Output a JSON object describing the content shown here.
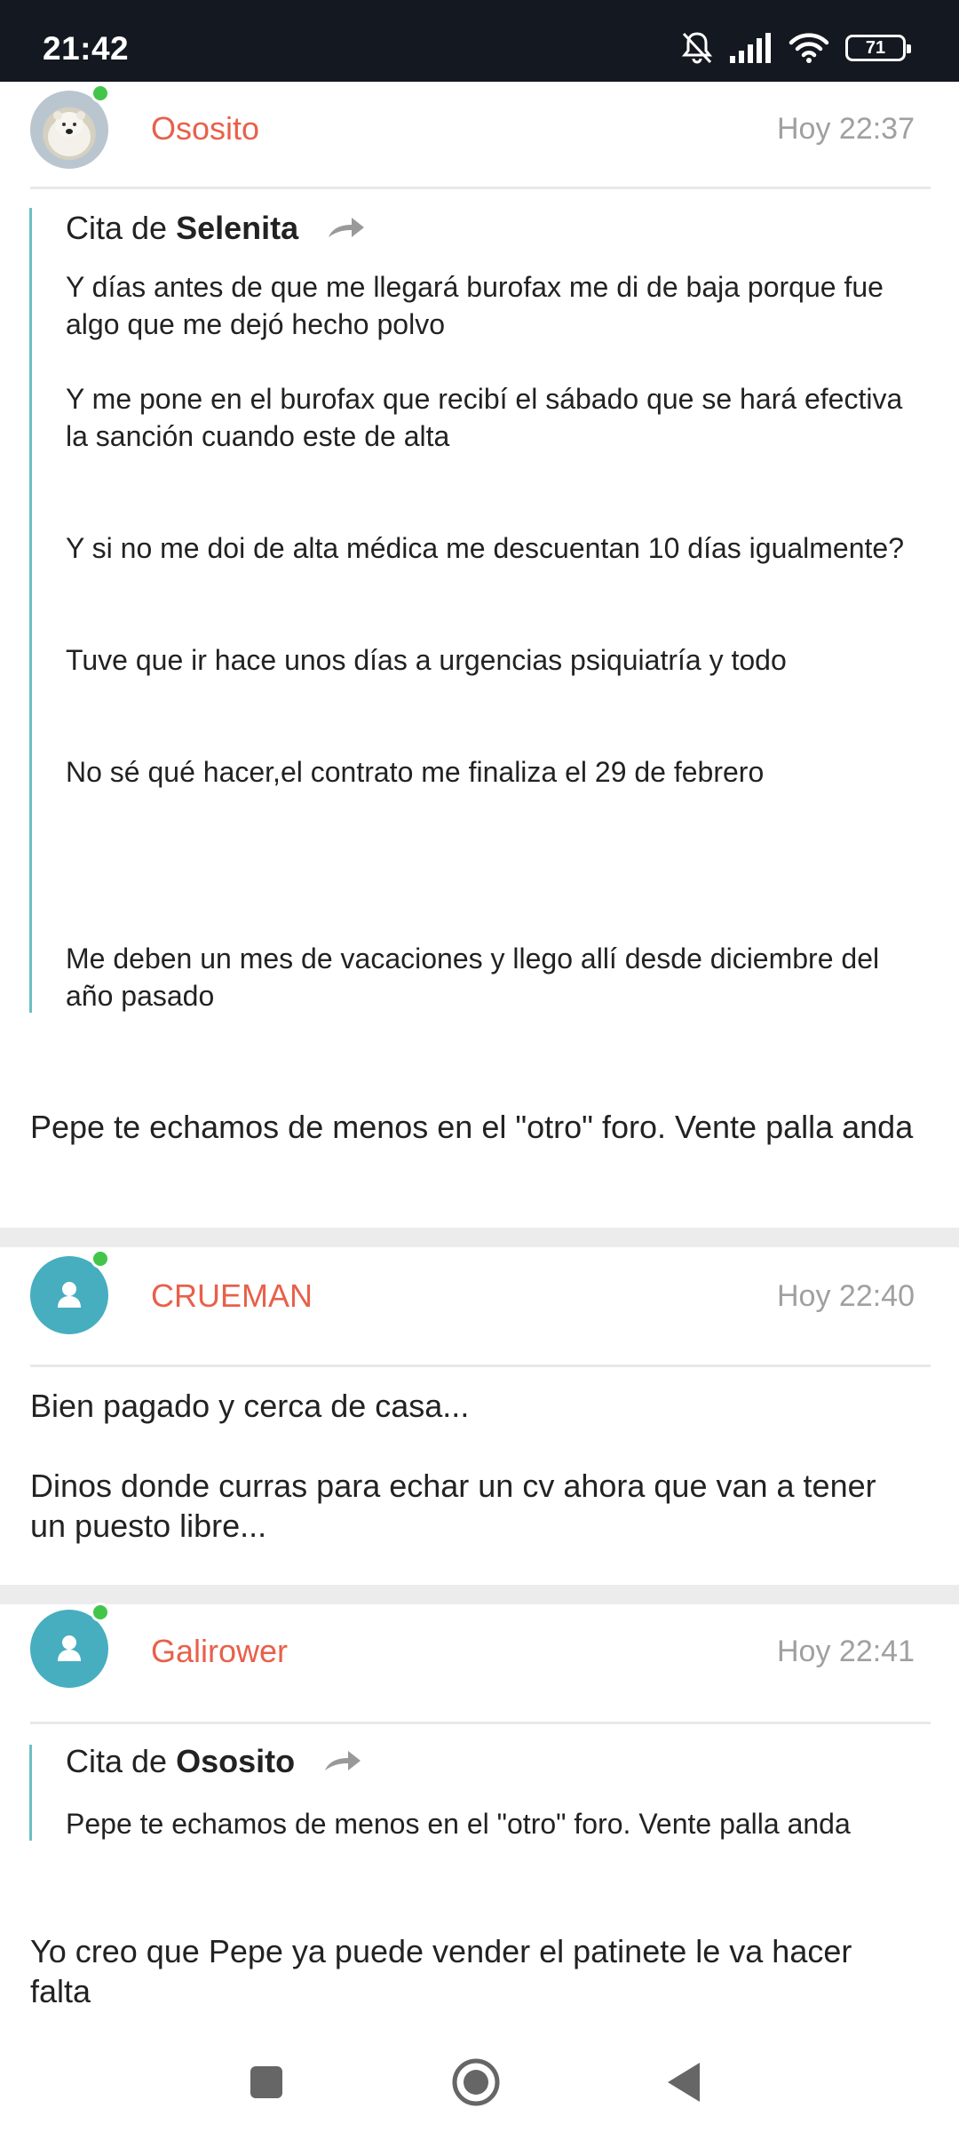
{
  "status_bar": {
    "time": "21:42",
    "battery": "71"
  },
  "posts": [
    {
      "username": "Ososito",
      "time": "Hoy 22:37",
      "quote": {
        "prefix": "Cita de",
        "author": "Selenita",
        "paragraphs": [
          "Y días antes de que me llegará burofax me di de baja porque fue algo que me dejó hecho polvo",
          "Y me pone en el burofax que recibí el sábado que se hará efectiva la sanción cuando este de alta",
          "Y si no me doi de alta médica me descuentan 10 días igualmente?",
          "Tuve que ir hace unos días a urgencias psiquiatría y todo",
          "No sé qué hacer,el contrato me finaliza el 29 de febrero",
          "Me deben un mes de vacaciones y llego allí desde diciembre del año pasado"
        ]
      },
      "body": [
        "Pepe te echamos de menos en el \"otro\" foro. Vente palla anda"
      ]
    },
    {
      "username": "CRUEMAN",
      "time": "Hoy 22:40",
      "body": [
        "Bien pagado y cerca de casa...",
        "Dinos donde curras para echar un cv ahora que van a tener un puesto libre..."
      ]
    },
    {
      "username": "Galirower",
      "time": "Hoy 22:41",
      "quote": {
        "prefix": "Cita de",
        "author": "Ososito",
        "paragraphs": [
          "Pepe te echamos de menos en el \"otro\" foro. Vente palla anda"
        ]
      },
      "body": [
        "Yo creo que Pepe ya puede vender el patinete le va hacer falta"
      ]
    }
  ],
  "icons": {
    "status": [
      "mute-icon",
      "signal-icon",
      "wifi-icon",
      "battery-icon"
    ],
    "share": "share-arrow-icon",
    "nav": [
      "recents-button",
      "home-button",
      "back-button"
    ]
  },
  "colors": {
    "username": "#e8604a",
    "avatar": "#46aebf",
    "online": "#43c54a",
    "quote_bar": "#6cbfc2",
    "status_bar": "#141820"
  }
}
